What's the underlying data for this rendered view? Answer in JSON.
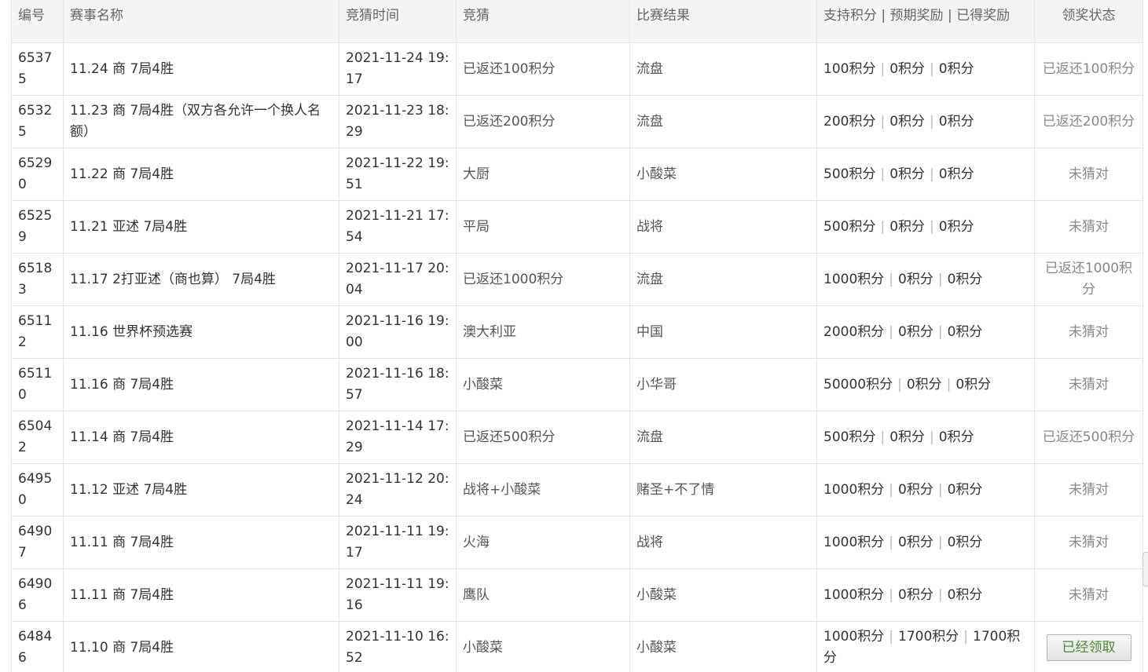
{
  "table": {
    "headers": {
      "id": "编号",
      "name": "赛事名称",
      "time": "竞猜时间",
      "guess": "竞猜",
      "result": "比赛结果",
      "points": "支持积分 | 预期奖励 | 已得奖励",
      "status": "领奖状态"
    },
    "rows": [
      {
        "id": "65375",
        "name": "11.24 商 7局4胜",
        "time": "2021-11-24 19:17",
        "guess": "已返还100积分",
        "result": "流盘",
        "support": "100积分",
        "expected": "0积分",
        "earned": "0积分",
        "status": "已返还100积分"
      },
      {
        "id": "65325",
        "name": "11.23 商 7局4胜（双方各允许一个换人名额）",
        "time": "2021-11-23 18:29",
        "guess": "已返还200积分",
        "result": "流盘",
        "support": "200积分",
        "expected": "0积分",
        "earned": "0积分",
        "status": "已返还200积分"
      },
      {
        "id": "65290",
        "name": "11.22 商 7局4胜",
        "time": "2021-11-22 19:51",
        "guess": "大厨",
        "result": "小酸菜",
        "support": "500积分",
        "expected": "0积分",
        "earned": "0积分",
        "status": "未猜对"
      },
      {
        "id": "65259",
        "name": "11.21 亚述 7局4胜",
        "time": "2021-11-21 17:54",
        "guess": "平局",
        "result": "战将",
        "support": "500积分",
        "expected": "0积分",
        "earned": "0积分",
        "status": "未猜对"
      },
      {
        "id": "65183",
        "name": "11.17 2打亚述（商也算） 7局4胜",
        "time": "2021-11-17 20:04",
        "guess": "已返还1000积分",
        "result": "流盘",
        "support": "1000积分",
        "expected": "0积分",
        "earned": "0积分",
        "status": "已返还1000积分"
      },
      {
        "id": "65112",
        "name": "11.16 世界杯预选赛",
        "time": "2021-11-16 19:00",
        "guess": "澳大利亚",
        "result": "中国",
        "support": "2000积分",
        "expected": "0积分",
        "earned": "0积分",
        "status": "未猜对"
      },
      {
        "id": "65110",
        "name": "11.16 商 7局4胜",
        "time": "2021-11-16 18:57",
        "guess": "小酸菜",
        "result": "小华哥",
        "support": "50000积分",
        "expected": "0积分",
        "earned": "0积分",
        "status": "未猜对"
      },
      {
        "id": "65042",
        "name": "11.14 商 7局4胜",
        "time": "2021-11-14 17:29",
        "guess": "已返还500积分",
        "result": "流盘",
        "support": "500积分",
        "expected": "0积分",
        "earned": "0积分",
        "status": "已返还500积分"
      },
      {
        "id": "64950",
        "name": "11.12 亚述 7局4胜",
        "time": "2021-11-12 20:24",
        "guess": "战将+小酸菜",
        "result": "赌圣+不了情",
        "support": "1000积分",
        "expected": "0积分",
        "earned": "0积分",
        "status": "未猜对"
      },
      {
        "id": "64907",
        "name": "11.11 商 7局4胜",
        "time": "2021-11-11 19:17",
        "guess": "火海",
        "result": "战将",
        "support": "1000积分",
        "expected": "0积分",
        "earned": "0积分",
        "status": "未猜对"
      },
      {
        "id": "64906",
        "name": "11.11 商 7局4胜",
        "time": "2021-11-11 19:16",
        "guess": "鹰队",
        "result": "小酸菜",
        "support": "1000积分",
        "expected": "0积分",
        "earned": "0积分",
        "status": "未猜对"
      },
      {
        "id": "64846",
        "name": "11.10 商 7局4胜",
        "time": "2021-11-10 16:52",
        "guess": "小酸菜",
        "result": "小酸菜",
        "support": "1000积分",
        "expected": "1700积分",
        "earned": "1700积分",
        "status": "已经领取",
        "status_is_button": true
      }
    ],
    "separator": "|"
  },
  "colors": {
    "header_bg": "#f4f4f4",
    "border": "#e5e5e5",
    "claim_text": "#4a8a34"
  }
}
